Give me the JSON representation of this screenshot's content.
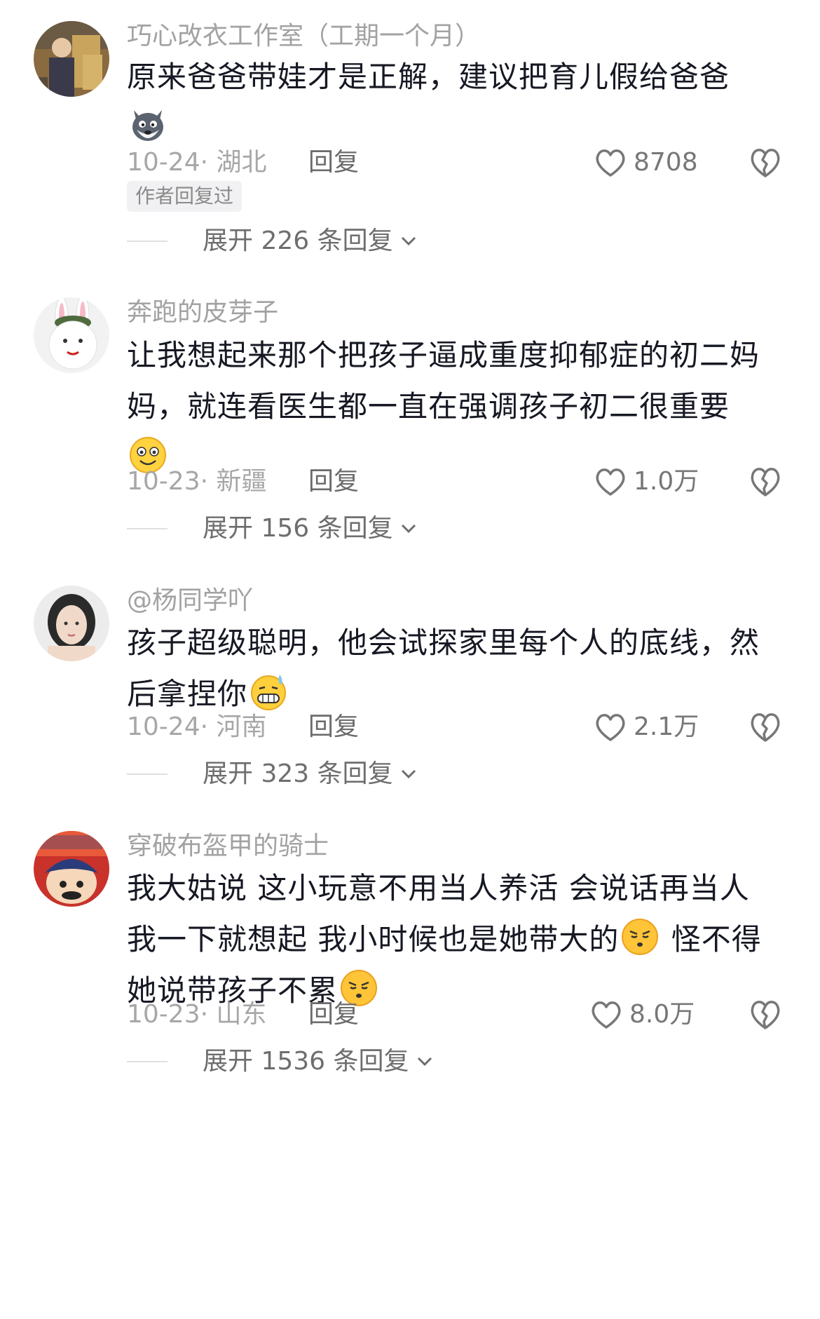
{
  "comments": [
    {
      "username": "巧心改衣工作室（工期一个月）",
      "text_lines": [
        "原来爸爸带娃才是正解，建议把育儿假给爸爸"
      ],
      "emoji": "husky-emoji",
      "date_location": "10-24· 湖北",
      "reply_label": "回复",
      "likes": "8708",
      "badge": "作者回复过",
      "expand_label": "展开 226 条回复"
    },
    {
      "username": "奔跑的皮芽子",
      "text_lines": [
        "让我想起来那个把孩子逼成重度抑郁症的初二妈",
        "妈，就连看医生都一直在强调孩子初二很重要"
      ],
      "emoji": "smile-emoji",
      "date_location": "10-23· 新疆",
      "reply_label": "回复",
      "likes": "1.0万",
      "expand_label": "展开 156 条回复"
    },
    {
      "username": "@杨同学吖",
      "text_lines": [
        "孩子超级聪明，他会试探家里每个人的底线，然",
        "后拿捏你"
      ],
      "emoji": "grimace-sweat-emoji",
      "date_location": "10-24· 河南",
      "reply_label": "回复",
      "likes": "2.1万",
      "expand_label": "展开 323 条回复"
    },
    {
      "username": "穿破布盔甲的骑士",
      "text_line1": "我大姑说 这小玩意不用当人养活 会说话再当人",
      "text_line2": "我一下就想起 我小时候也是她带大的",
      "text_line2_tail": " 怪不得",
      "text_line3": "她说带孩子不累",
      "emoji": "smug-emoji",
      "date_location": "10-23· 山东",
      "reply_label": "回复",
      "likes": "8.0万",
      "expand_label": "展开 1536 条回复"
    }
  ]
}
